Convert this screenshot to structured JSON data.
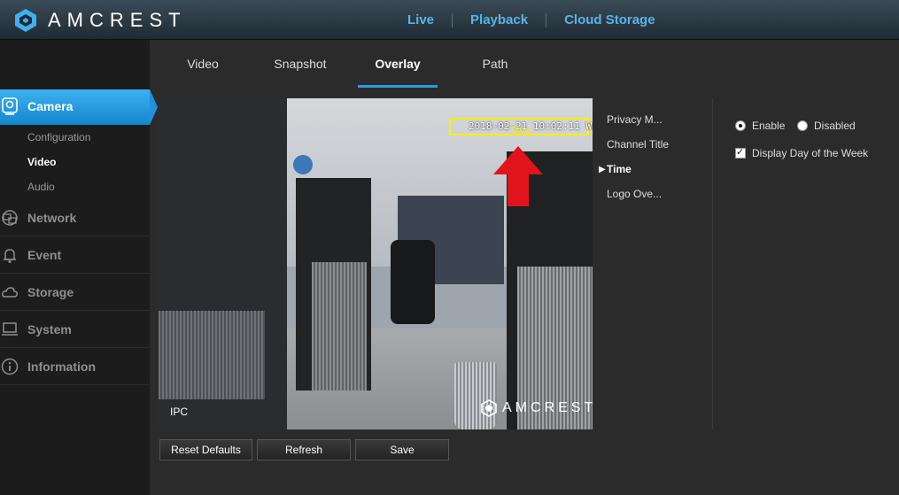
{
  "brand": {
    "name": "AMCREST"
  },
  "topnav": {
    "live": "Live",
    "playback": "Playback",
    "cloud": "Cloud Storage"
  },
  "sidebar": {
    "camera": "Camera",
    "sub": {
      "configuration": "Configuration",
      "video": "Video",
      "audio": "Audio"
    },
    "network": "Network",
    "event": "Event",
    "storage": "Storage",
    "system": "System",
    "information": "Information"
  },
  "tabs": {
    "video": "Video",
    "snapshot": "Snapshot",
    "overlay": "Overlay",
    "path": "Path"
  },
  "preview": {
    "time_text": "2018-02-21 10:02:11 Wed",
    "time_label": "Time",
    "channel_label": "IPC",
    "watermark": "AMCREST"
  },
  "buttons": {
    "reset": "Reset Defaults",
    "refresh": "Refresh",
    "save": "Save"
  },
  "overlay_menu": {
    "privacy": "Privacy M...",
    "channel_title": "Channel Title",
    "time": "Time",
    "logo": "Logo Ove..."
  },
  "options": {
    "enable": "Enable",
    "disabled": "Disabled",
    "enabled_selected": true,
    "day_of_week": "Display Day of the Week",
    "day_of_week_checked": true
  },
  "colors": {
    "accent": "#2a9be0",
    "highlight": "#ffee00",
    "arrow": "#e0141a"
  }
}
